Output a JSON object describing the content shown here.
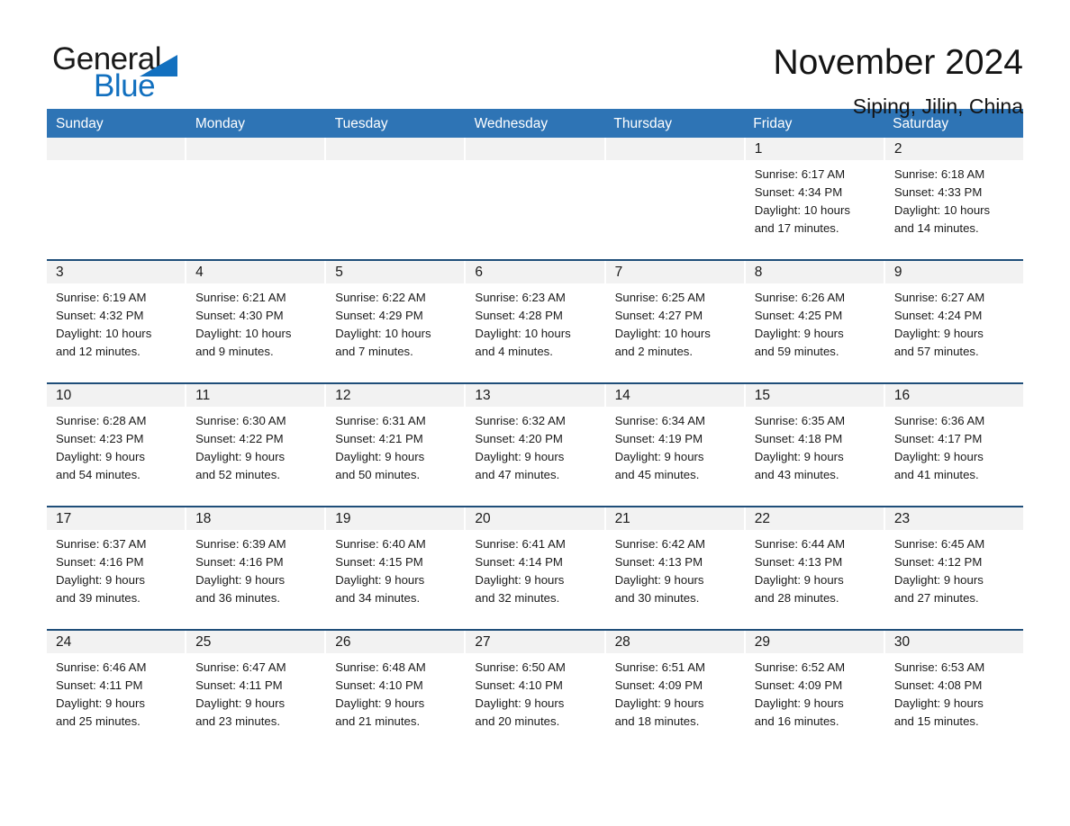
{
  "brand": {
    "name_part1": "General",
    "name_part2": "Blue",
    "accent_color": "#1270bf",
    "flag_icon": "triangle-flag-icon"
  },
  "header": {
    "title": "November 2024",
    "location": "Siping, Jilin, China"
  },
  "theme": {
    "header_blue": "#2e74b5",
    "week_rule": "#1f4e79",
    "daynum_band": "#f2f2f2",
    "text": "#1a1a1a"
  },
  "weekdays": [
    "Sunday",
    "Monday",
    "Tuesday",
    "Wednesday",
    "Thursday",
    "Friday",
    "Saturday"
  ],
  "labels": {
    "sunrise_prefix": "Sunrise:",
    "sunset_prefix": "Sunset:",
    "daylight_prefix": "Daylight:"
  },
  "weeks": [
    [
      {
        "day": "",
        "empty": true
      },
      {
        "day": "",
        "empty": true
      },
      {
        "day": "",
        "empty": true
      },
      {
        "day": "",
        "empty": true
      },
      {
        "day": "",
        "empty": true
      },
      {
        "day": "1",
        "sunrise": "Sunrise: 6:17 AM",
        "sunset": "Sunset: 4:34 PM",
        "daylight_line1": "Daylight: 10 hours",
        "daylight_line2": "and 17 minutes."
      },
      {
        "day": "2",
        "sunrise": "Sunrise: 6:18 AM",
        "sunset": "Sunset: 4:33 PM",
        "daylight_line1": "Daylight: 10 hours",
        "daylight_line2": "and 14 minutes."
      }
    ],
    [
      {
        "day": "3",
        "sunrise": "Sunrise: 6:19 AM",
        "sunset": "Sunset: 4:32 PM",
        "daylight_line1": "Daylight: 10 hours",
        "daylight_line2": "and 12 minutes."
      },
      {
        "day": "4",
        "sunrise": "Sunrise: 6:21 AM",
        "sunset": "Sunset: 4:30 PM",
        "daylight_line1": "Daylight: 10 hours",
        "daylight_line2": "and 9 minutes."
      },
      {
        "day": "5",
        "sunrise": "Sunrise: 6:22 AM",
        "sunset": "Sunset: 4:29 PM",
        "daylight_line1": "Daylight: 10 hours",
        "daylight_line2": "and 7 minutes."
      },
      {
        "day": "6",
        "sunrise": "Sunrise: 6:23 AM",
        "sunset": "Sunset: 4:28 PM",
        "daylight_line1": "Daylight: 10 hours",
        "daylight_line2": "and 4 minutes."
      },
      {
        "day": "7",
        "sunrise": "Sunrise: 6:25 AM",
        "sunset": "Sunset: 4:27 PM",
        "daylight_line1": "Daylight: 10 hours",
        "daylight_line2": "and 2 minutes."
      },
      {
        "day": "8",
        "sunrise": "Sunrise: 6:26 AM",
        "sunset": "Sunset: 4:25 PM",
        "daylight_line1": "Daylight: 9 hours",
        "daylight_line2": "and 59 minutes."
      },
      {
        "day": "9",
        "sunrise": "Sunrise: 6:27 AM",
        "sunset": "Sunset: 4:24 PM",
        "daylight_line1": "Daylight: 9 hours",
        "daylight_line2": "and 57 minutes."
      }
    ],
    [
      {
        "day": "10",
        "sunrise": "Sunrise: 6:28 AM",
        "sunset": "Sunset: 4:23 PM",
        "daylight_line1": "Daylight: 9 hours",
        "daylight_line2": "and 54 minutes."
      },
      {
        "day": "11",
        "sunrise": "Sunrise: 6:30 AM",
        "sunset": "Sunset: 4:22 PM",
        "daylight_line1": "Daylight: 9 hours",
        "daylight_line2": "and 52 minutes."
      },
      {
        "day": "12",
        "sunrise": "Sunrise: 6:31 AM",
        "sunset": "Sunset: 4:21 PM",
        "daylight_line1": "Daylight: 9 hours",
        "daylight_line2": "and 50 minutes."
      },
      {
        "day": "13",
        "sunrise": "Sunrise: 6:32 AM",
        "sunset": "Sunset: 4:20 PM",
        "daylight_line1": "Daylight: 9 hours",
        "daylight_line2": "and 47 minutes."
      },
      {
        "day": "14",
        "sunrise": "Sunrise: 6:34 AM",
        "sunset": "Sunset: 4:19 PM",
        "daylight_line1": "Daylight: 9 hours",
        "daylight_line2": "and 45 minutes."
      },
      {
        "day": "15",
        "sunrise": "Sunrise: 6:35 AM",
        "sunset": "Sunset: 4:18 PM",
        "daylight_line1": "Daylight: 9 hours",
        "daylight_line2": "and 43 minutes."
      },
      {
        "day": "16",
        "sunrise": "Sunrise: 6:36 AM",
        "sunset": "Sunset: 4:17 PM",
        "daylight_line1": "Daylight: 9 hours",
        "daylight_line2": "and 41 minutes."
      }
    ],
    [
      {
        "day": "17",
        "sunrise": "Sunrise: 6:37 AM",
        "sunset": "Sunset: 4:16 PM",
        "daylight_line1": "Daylight: 9 hours",
        "daylight_line2": "and 39 minutes."
      },
      {
        "day": "18",
        "sunrise": "Sunrise: 6:39 AM",
        "sunset": "Sunset: 4:16 PM",
        "daylight_line1": "Daylight: 9 hours",
        "daylight_line2": "and 36 minutes."
      },
      {
        "day": "19",
        "sunrise": "Sunrise: 6:40 AM",
        "sunset": "Sunset: 4:15 PM",
        "daylight_line1": "Daylight: 9 hours",
        "daylight_line2": "and 34 minutes."
      },
      {
        "day": "20",
        "sunrise": "Sunrise: 6:41 AM",
        "sunset": "Sunset: 4:14 PM",
        "daylight_line1": "Daylight: 9 hours",
        "daylight_line2": "and 32 minutes."
      },
      {
        "day": "21",
        "sunrise": "Sunrise: 6:42 AM",
        "sunset": "Sunset: 4:13 PM",
        "daylight_line1": "Daylight: 9 hours",
        "daylight_line2": "and 30 minutes."
      },
      {
        "day": "22",
        "sunrise": "Sunrise: 6:44 AM",
        "sunset": "Sunset: 4:13 PM",
        "daylight_line1": "Daylight: 9 hours",
        "daylight_line2": "and 28 minutes."
      },
      {
        "day": "23",
        "sunrise": "Sunrise: 6:45 AM",
        "sunset": "Sunset: 4:12 PM",
        "daylight_line1": "Daylight: 9 hours",
        "daylight_line2": "and 27 minutes."
      }
    ],
    [
      {
        "day": "24",
        "sunrise": "Sunrise: 6:46 AM",
        "sunset": "Sunset: 4:11 PM",
        "daylight_line1": "Daylight: 9 hours",
        "daylight_line2": "and 25 minutes."
      },
      {
        "day": "25",
        "sunrise": "Sunrise: 6:47 AM",
        "sunset": "Sunset: 4:11 PM",
        "daylight_line1": "Daylight: 9 hours",
        "daylight_line2": "and 23 minutes."
      },
      {
        "day": "26",
        "sunrise": "Sunrise: 6:48 AM",
        "sunset": "Sunset: 4:10 PM",
        "daylight_line1": "Daylight: 9 hours",
        "daylight_line2": "and 21 minutes."
      },
      {
        "day": "27",
        "sunrise": "Sunrise: 6:50 AM",
        "sunset": "Sunset: 4:10 PM",
        "daylight_line1": "Daylight: 9 hours",
        "daylight_line2": "and 20 minutes."
      },
      {
        "day": "28",
        "sunrise": "Sunrise: 6:51 AM",
        "sunset": "Sunset: 4:09 PM",
        "daylight_line1": "Daylight: 9 hours",
        "daylight_line2": "and 18 minutes."
      },
      {
        "day": "29",
        "sunrise": "Sunrise: 6:52 AM",
        "sunset": "Sunset: 4:09 PM",
        "daylight_line1": "Daylight: 9 hours",
        "daylight_line2": "and 16 minutes."
      },
      {
        "day": "30",
        "sunrise": "Sunrise: 6:53 AM",
        "sunset": "Sunset: 4:08 PM",
        "daylight_line1": "Daylight: 9 hours",
        "daylight_line2": "and 15 minutes."
      }
    ]
  ]
}
